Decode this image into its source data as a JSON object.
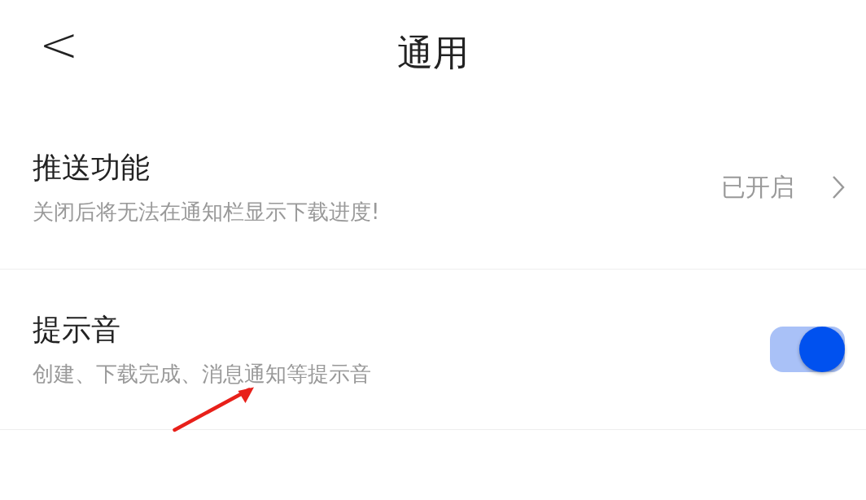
{
  "header": {
    "back": "<",
    "title": "通用"
  },
  "settings": [
    {
      "kind": "link",
      "title": "推送功能",
      "subtitle": "关闭后将无法在通知栏显示下载进度!",
      "value": "已开启"
    },
    {
      "kind": "toggle",
      "title": "提示音",
      "subtitle": "创建、下载完成、消息通知等提示音",
      "on": true
    }
  ]
}
